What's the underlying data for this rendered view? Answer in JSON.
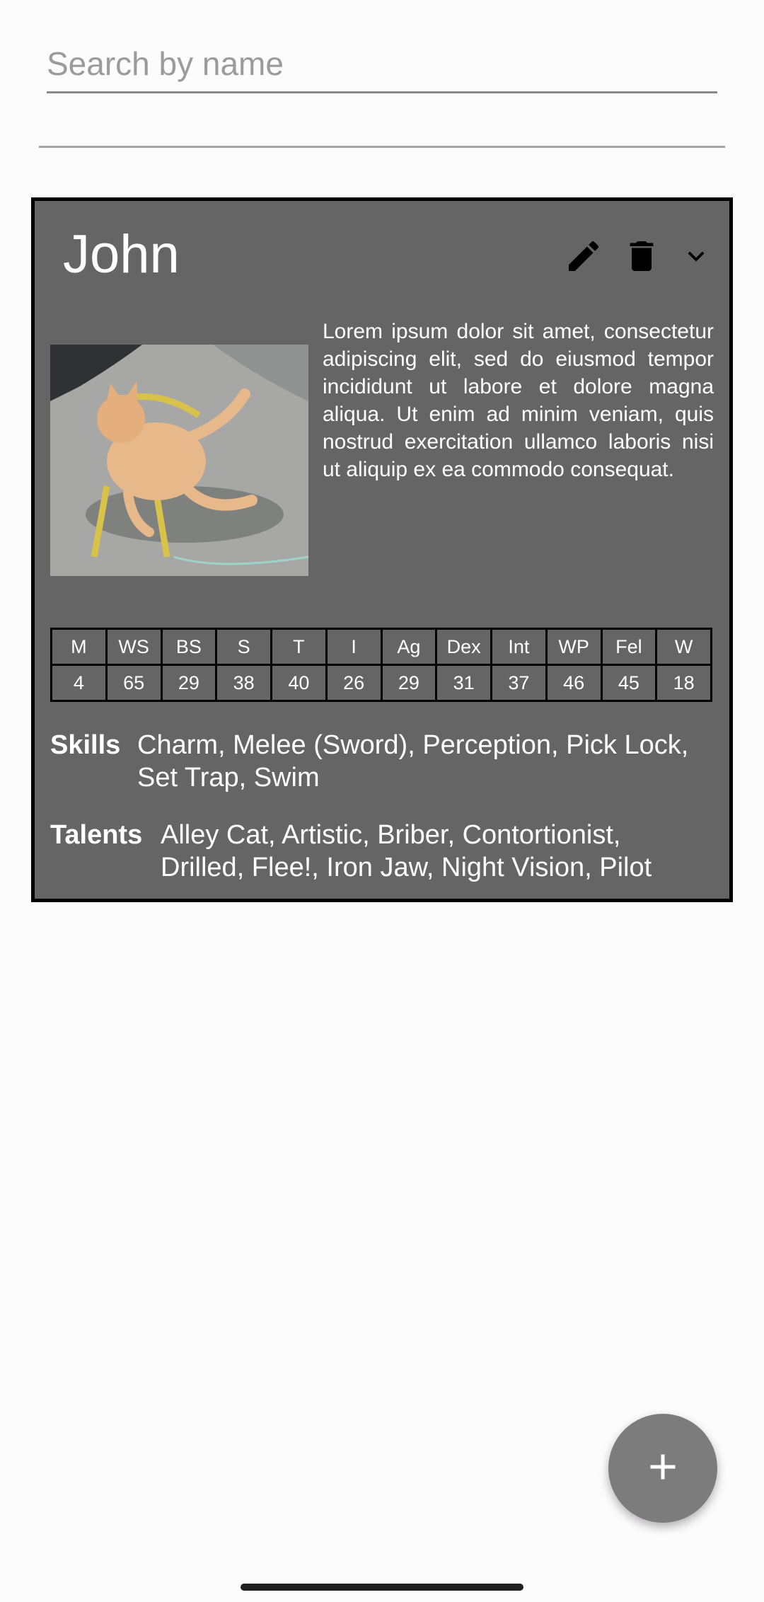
{
  "search": {
    "placeholder": "Search by name",
    "value": ""
  },
  "character": {
    "name": "John",
    "description": "Lorem ipsum dolor sit amet, consectetur adipiscing elit, sed do eiusmod tempor incididunt ut labore et dolore magna aliqua. Ut enim ad minim veniam, quis nostrud exercitation ullamco laboris nisi ut aliquip ex ea commodo consequat.",
    "stats": {
      "headers": [
        "M",
        "WS",
        "BS",
        "S",
        "T",
        "I",
        "Ag",
        "Dex",
        "Int",
        "WP",
        "Fel",
        "W"
      ],
      "values": [
        "4",
        "65",
        "29",
        "38",
        "40",
        "26",
        "29",
        "31",
        "37",
        "46",
        "45",
        "18"
      ]
    },
    "skills_label": "Skills",
    "skills": "Charm, Melee (Sword), Perception, Pick Lock, Set Trap, Swim",
    "talents_label": "Talents",
    "talents": "Alley Cat, Artistic, Briber, Contortionist, Drilled, Flee!, Iron Jaw, Night Vision, Pilot"
  },
  "icons": {
    "edit": "pencil-icon",
    "delete": "trash-icon",
    "expand": "chevron-down-icon",
    "add": "plus-icon"
  },
  "colors": {
    "card_background": "#656565",
    "fab_background": "#7c7c7c"
  }
}
